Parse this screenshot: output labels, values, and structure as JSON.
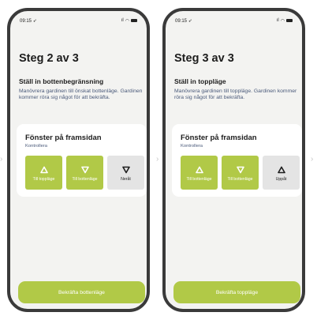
{
  "colors": {
    "accent": "#b1c947",
    "frame": "#3a3a3a",
    "screen_bg": "#f3f3f1"
  },
  "screens": [
    {
      "status": {
        "time": "09:15",
        "location_icon": "location-arrow-icon"
      },
      "step_title": "Steg 2 av 3",
      "section_title": "Ställ in bottenbegränsning",
      "description": "Manövrera gardinen till önskat bottenläge. Gardinen kommer röra sig något för att bekräfta.",
      "card": {
        "title": "Fönster på framsidan",
        "subtitle": "Kontrollera",
        "buttons": [
          {
            "label": "Till toppläge",
            "icon": "outline-up-triangle-icon",
            "style": "green"
          },
          {
            "label": "Till bottenläge",
            "icon": "outline-down-triangle-icon",
            "style": "green"
          },
          {
            "label": "Neråt",
            "icon": "outline-down-triangle-icon",
            "style": "grey"
          }
        ]
      },
      "confirm_label": "Bekräfta bottenläge"
    },
    {
      "status": {
        "time": "09:15",
        "location_icon": "location-arrow-icon"
      },
      "step_title": "Steg 3 av 3",
      "section_title": "Ställ in toppläge",
      "description": "Manövrera gardinen till toppläge. Gardinen kommer röra sig något för att bekräfta.",
      "card": {
        "title": "Fönster på framsidan",
        "subtitle": "Kontrollera",
        "buttons": [
          {
            "label": "Till bottenläge",
            "icon": "outline-up-triangle-icon",
            "style": "green"
          },
          {
            "label": "Till bottenläge",
            "icon": "outline-down-triangle-icon",
            "style": "green"
          },
          {
            "label": "Uppåt",
            "icon": "outline-up-triangle-icon",
            "style": "grey"
          }
        ]
      },
      "confirm_label": "Bekräfta toppläge"
    }
  ]
}
